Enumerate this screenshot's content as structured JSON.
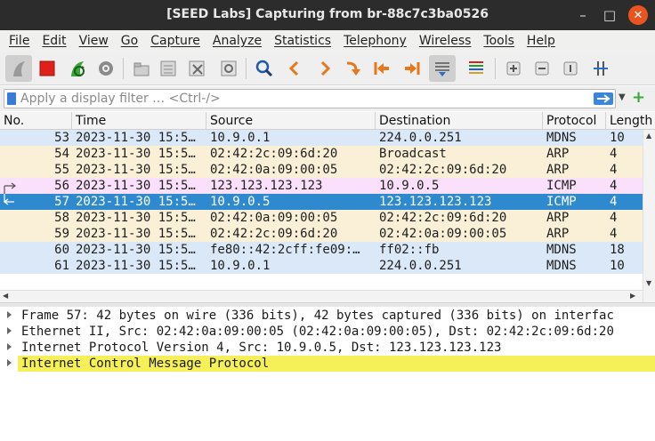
{
  "window": {
    "title": "[SEED Labs] Capturing from br-88c7c3ba0526"
  },
  "menu": [
    "File",
    "Edit",
    "View",
    "Go",
    "Capture",
    "Analyze",
    "Statistics",
    "Telephony",
    "Wireless",
    "Tools",
    "Help"
  ],
  "toolbar": {
    "icons": [
      "shark-fin-start-icon",
      "stop-capture-icon",
      "restart-capture-icon",
      "capture-options-icon",
      "open-file-icon",
      "save-file-icon",
      "close-file-icon",
      "reload-file-icon",
      "find-packet-icon",
      "go-back-icon",
      "go-forward-icon",
      "go-to-packet-icon",
      "go-first-icon",
      "go-last-icon",
      "auto-scroll-icon",
      "colorize-icon",
      "zoom-in-icon",
      "zoom-out-icon",
      "zoom-normal-icon",
      "resize-columns-icon"
    ]
  },
  "filter": {
    "placeholder": "Apply a display filter … <Ctrl-/>"
  },
  "columns": [
    "No.",
    "Time",
    "Source",
    "Destination",
    "Protocol",
    "Length"
  ],
  "packets": [
    {
      "no": "53",
      "time": "2023-11-30 15:5…",
      "src": "10.9.0.1",
      "dst": "224.0.0.251",
      "proto": "MDNS",
      "len": "10",
      "bg": "#dae8f8",
      "fg": "#1e1e1e"
    },
    {
      "no": "54",
      "time": "2023-11-30 15:5…",
      "src": "02:42:2c:09:6d:20",
      "dst": "Broadcast",
      "proto": "ARP",
      "len": "4",
      "bg": "#faf0d7",
      "fg": "#1e1e1e"
    },
    {
      "no": "55",
      "time": "2023-11-30 15:5…",
      "src": "02:42:0a:09:00:05",
      "dst": "02:42:2c:09:6d:20",
      "proto": "ARP",
      "len": "4",
      "bg": "#faf0d7",
      "fg": "#1e1e1e"
    },
    {
      "no": "56",
      "time": "2023-11-30 15:5…",
      "src": "123.123.123.123",
      "dst": "10.9.0.5",
      "proto": "ICMP",
      "len": "4",
      "bg": "#fbe0fb",
      "fg": "#1e1e1e"
    },
    {
      "no": "57",
      "time": "2023-11-30 15:5…",
      "src": "10.9.0.5",
      "dst": "123.123.123.123",
      "proto": "ICMP",
      "len": "4",
      "bg": "#2f89cf",
      "fg": "#ffffff"
    },
    {
      "no": "58",
      "time": "2023-11-30 15:5…",
      "src": "02:42:0a:09:00:05",
      "dst": "02:42:2c:09:6d:20",
      "proto": "ARP",
      "len": "4",
      "bg": "#faf0d7",
      "fg": "#1e1e1e"
    },
    {
      "no": "59",
      "time": "2023-11-30 15:5…",
      "src": "02:42:2c:09:6d:20",
      "dst": "02:42:0a:09:00:05",
      "proto": "ARP",
      "len": "4",
      "bg": "#faf0d7",
      "fg": "#1e1e1e"
    },
    {
      "no": "60",
      "time": "2023-11-30 15:5…",
      "src": "fe80::42:2cff:fe09:…",
      "dst": "ff02::fb",
      "proto": "MDNS",
      "len": "18",
      "bg": "#dae8f8",
      "fg": "#1e1e1e"
    },
    {
      "no": "61",
      "time": "2023-11-30 15:5…",
      "src": "10.9.0.1",
      "dst": "224.0.0.251",
      "proto": "MDNS",
      "len": "10",
      "bg": "#dae8f8",
      "fg": "#1e1e1e"
    }
  ],
  "details": [
    {
      "text": "Frame 57: 42 bytes on wire (336 bits), 42 bytes captured (336 bits) on interfac",
      "selected": false
    },
    {
      "text": "Ethernet II, Src: 02:42:0a:09:00:05 (02:42:0a:09:00:05), Dst: 02:42:2c:09:6d:20",
      "selected": false
    },
    {
      "text": "Internet Protocol Version 4, Src: 10.9.0.5, Dst: 123.123.123.123",
      "selected": false
    },
    {
      "text": "Internet Control Message Protocol",
      "selected": true
    }
  ]
}
